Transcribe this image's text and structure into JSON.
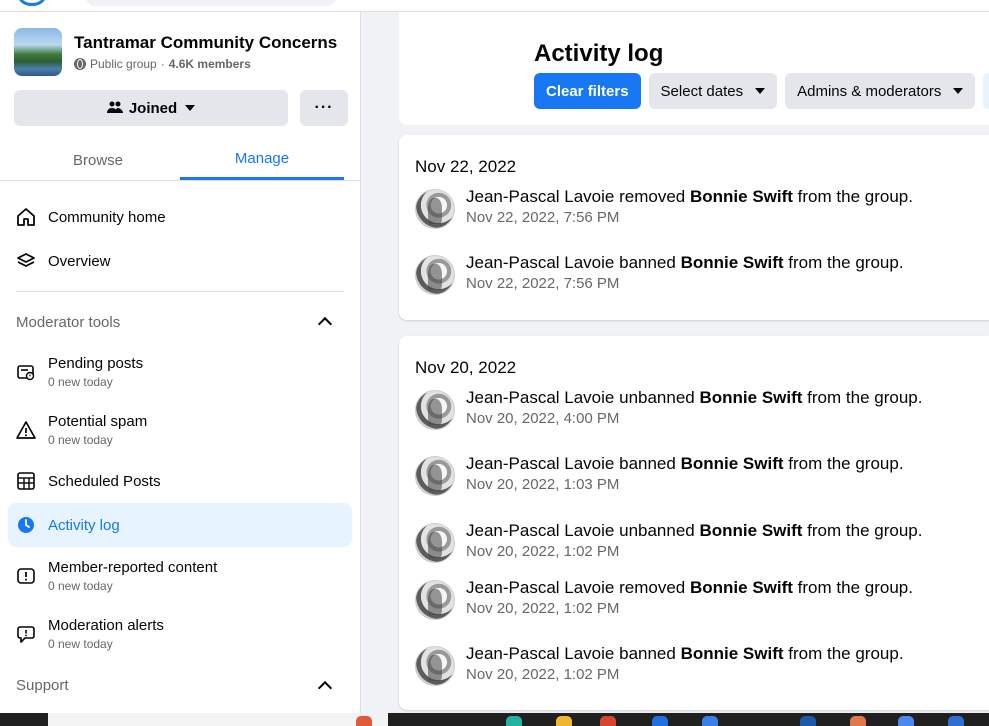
{
  "group": {
    "name": "Tantramar Community Concerns",
    "privacy": "Public group",
    "separator": "·",
    "members": "4.6K members",
    "joined_label": "Joined",
    "more_label": "···"
  },
  "tabs": {
    "browse": "Browse",
    "manage": "Manage"
  },
  "nav": {
    "community_home": "Community home",
    "overview": "Overview"
  },
  "moderator_tools": {
    "title": "Moderator tools",
    "items": [
      {
        "label": "Pending posts",
        "sub": "0 new today"
      },
      {
        "label": "Potential spam",
        "sub": "0 new today"
      },
      {
        "label": "Scheduled Posts",
        "sub": ""
      },
      {
        "label": "Activity log",
        "sub": ""
      },
      {
        "label": "Member-reported content",
        "sub": "0 new today"
      },
      {
        "label": "Moderation alerts",
        "sub": "0 new today"
      }
    ]
  },
  "support": {
    "title": "Support"
  },
  "header": {
    "title": "Activity log",
    "filters": {
      "clear": "Clear filters",
      "dates": "Select dates",
      "admins": "Admins & moderators"
    }
  },
  "log": [
    {
      "date": "Nov 22, 2022",
      "entries": [
        {
          "actor": "Jean-Pascal Lavoie",
          "verb": "removed",
          "target": "Bonnie Swift",
          "tail": "from the group.",
          "time": "Nov 22, 2022, 7:56 PM"
        },
        {
          "actor": "Jean-Pascal Lavoie",
          "verb": "banned",
          "target": "Bonnie Swift",
          "tail": "from the group.",
          "time": "Nov 22, 2022, 7:56 PM"
        }
      ]
    },
    {
      "date": "Nov 20, 2022",
      "entries": [
        {
          "actor": "Jean-Pascal Lavoie",
          "verb": "unbanned",
          "target": "Bonnie Swift",
          "tail": "from the group.",
          "time": "Nov 20, 2022, 4:00 PM"
        },
        {
          "actor": "Jean-Pascal Lavoie",
          "verb": "banned",
          "target": "Bonnie Swift",
          "tail": "from the group.",
          "time": "Nov 20, 2022, 1:03 PM"
        },
        {
          "actor": "Jean-Pascal Lavoie",
          "verb": "unbanned",
          "target": "Bonnie Swift",
          "tail": "from the group.",
          "time": "Nov 20, 2022, 1:02 PM"
        },
        {
          "actor": "Jean-Pascal Lavoie",
          "verb": "removed",
          "target": "Bonnie Swift",
          "tail": "from the group.",
          "time": "Nov 20, 2022, 1:02 PM"
        },
        {
          "actor": "Jean-Pascal Lavoie",
          "verb": "banned",
          "target": "Bonnie Swift",
          "tail": "from the group.",
          "time": "Nov 20, 2022, 1:02 PM"
        }
      ]
    }
  ],
  "colors": {
    "accent": "#1877f2",
    "accent_bg": "#e7f3ff",
    "secondary_text": "#65676b",
    "button_bg": "#e4e6eb"
  }
}
